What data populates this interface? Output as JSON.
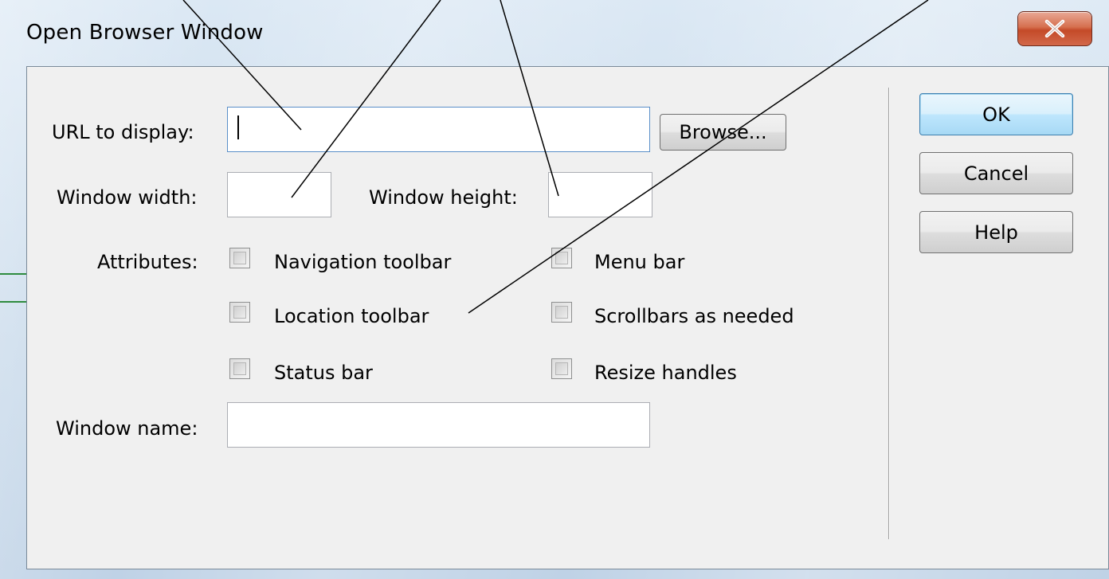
{
  "window": {
    "title": "Open Browser Window",
    "close_icon": "close-x-icon"
  },
  "form": {
    "url_label": "URL to display:",
    "url_value": "",
    "browse_label": "Browse...",
    "width_label": "Window width:",
    "width_value": "",
    "height_label": "Window height:",
    "height_value": "",
    "attributes_label": "Attributes:",
    "attributes": [
      {
        "label": "Navigation toolbar",
        "checked": false
      },
      {
        "label": "Menu bar",
        "checked": false
      },
      {
        "label": "Location toolbar",
        "checked": false
      },
      {
        "label": "Scrollbars as needed",
        "checked": false
      },
      {
        "label": "Status bar",
        "checked": false
      },
      {
        "label": "Resize handles",
        "checked": false
      }
    ],
    "name_label": "Window name:",
    "name_value": ""
  },
  "buttons": {
    "ok": "OK",
    "cancel": "Cancel",
    "help": "Help"
  },
  "colors": {
    "default_button_border": "#3c7fb1",
    "close_button": "#c44a28"
  }
}
